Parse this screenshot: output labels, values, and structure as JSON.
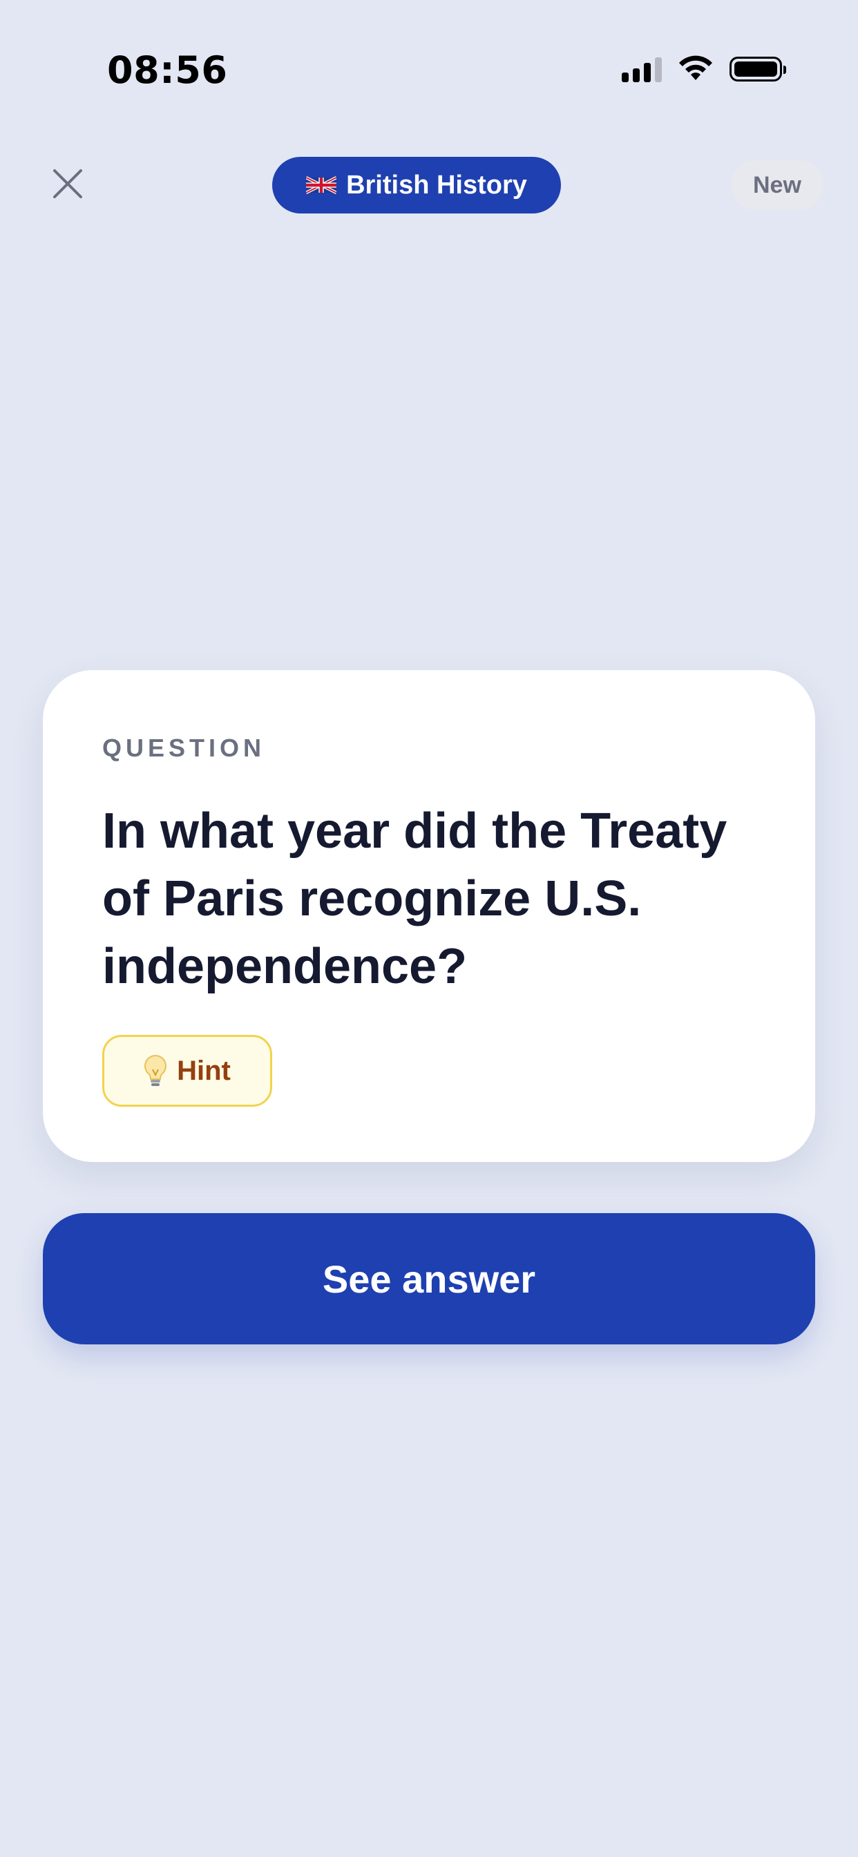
{
  "status_bar": {
    "time": "08:56",
    "icons": [
      "cellular-signal-icon",
      "wifi-icon",
      "battery-icon"
    ]
  },
  "header": {
    "close_icon": "close-icon",
    "topic": {
      "flag_icon": "uk-flag-icon",
      "label": "British History"
    },
    "badge": "New"
  },
  "card": {
    "label": "QUESTION",
    "question": "In what year did the Treaty of Paris recognize U.S. independence?",
    "hint": {
      "icon": "lightbulb-icon",
      "label": "Hint"
    }
  },
  "actions": {
    "primary_label": "See answer"
  },
  "colors": {
    "background": "#e3e7f3",
    "accent": "#1f40b0",
    "hint_background": "#fefbe6",
    "hint_border": "#f2d34e",
    "hint_text": "#94400f"
  }
}
